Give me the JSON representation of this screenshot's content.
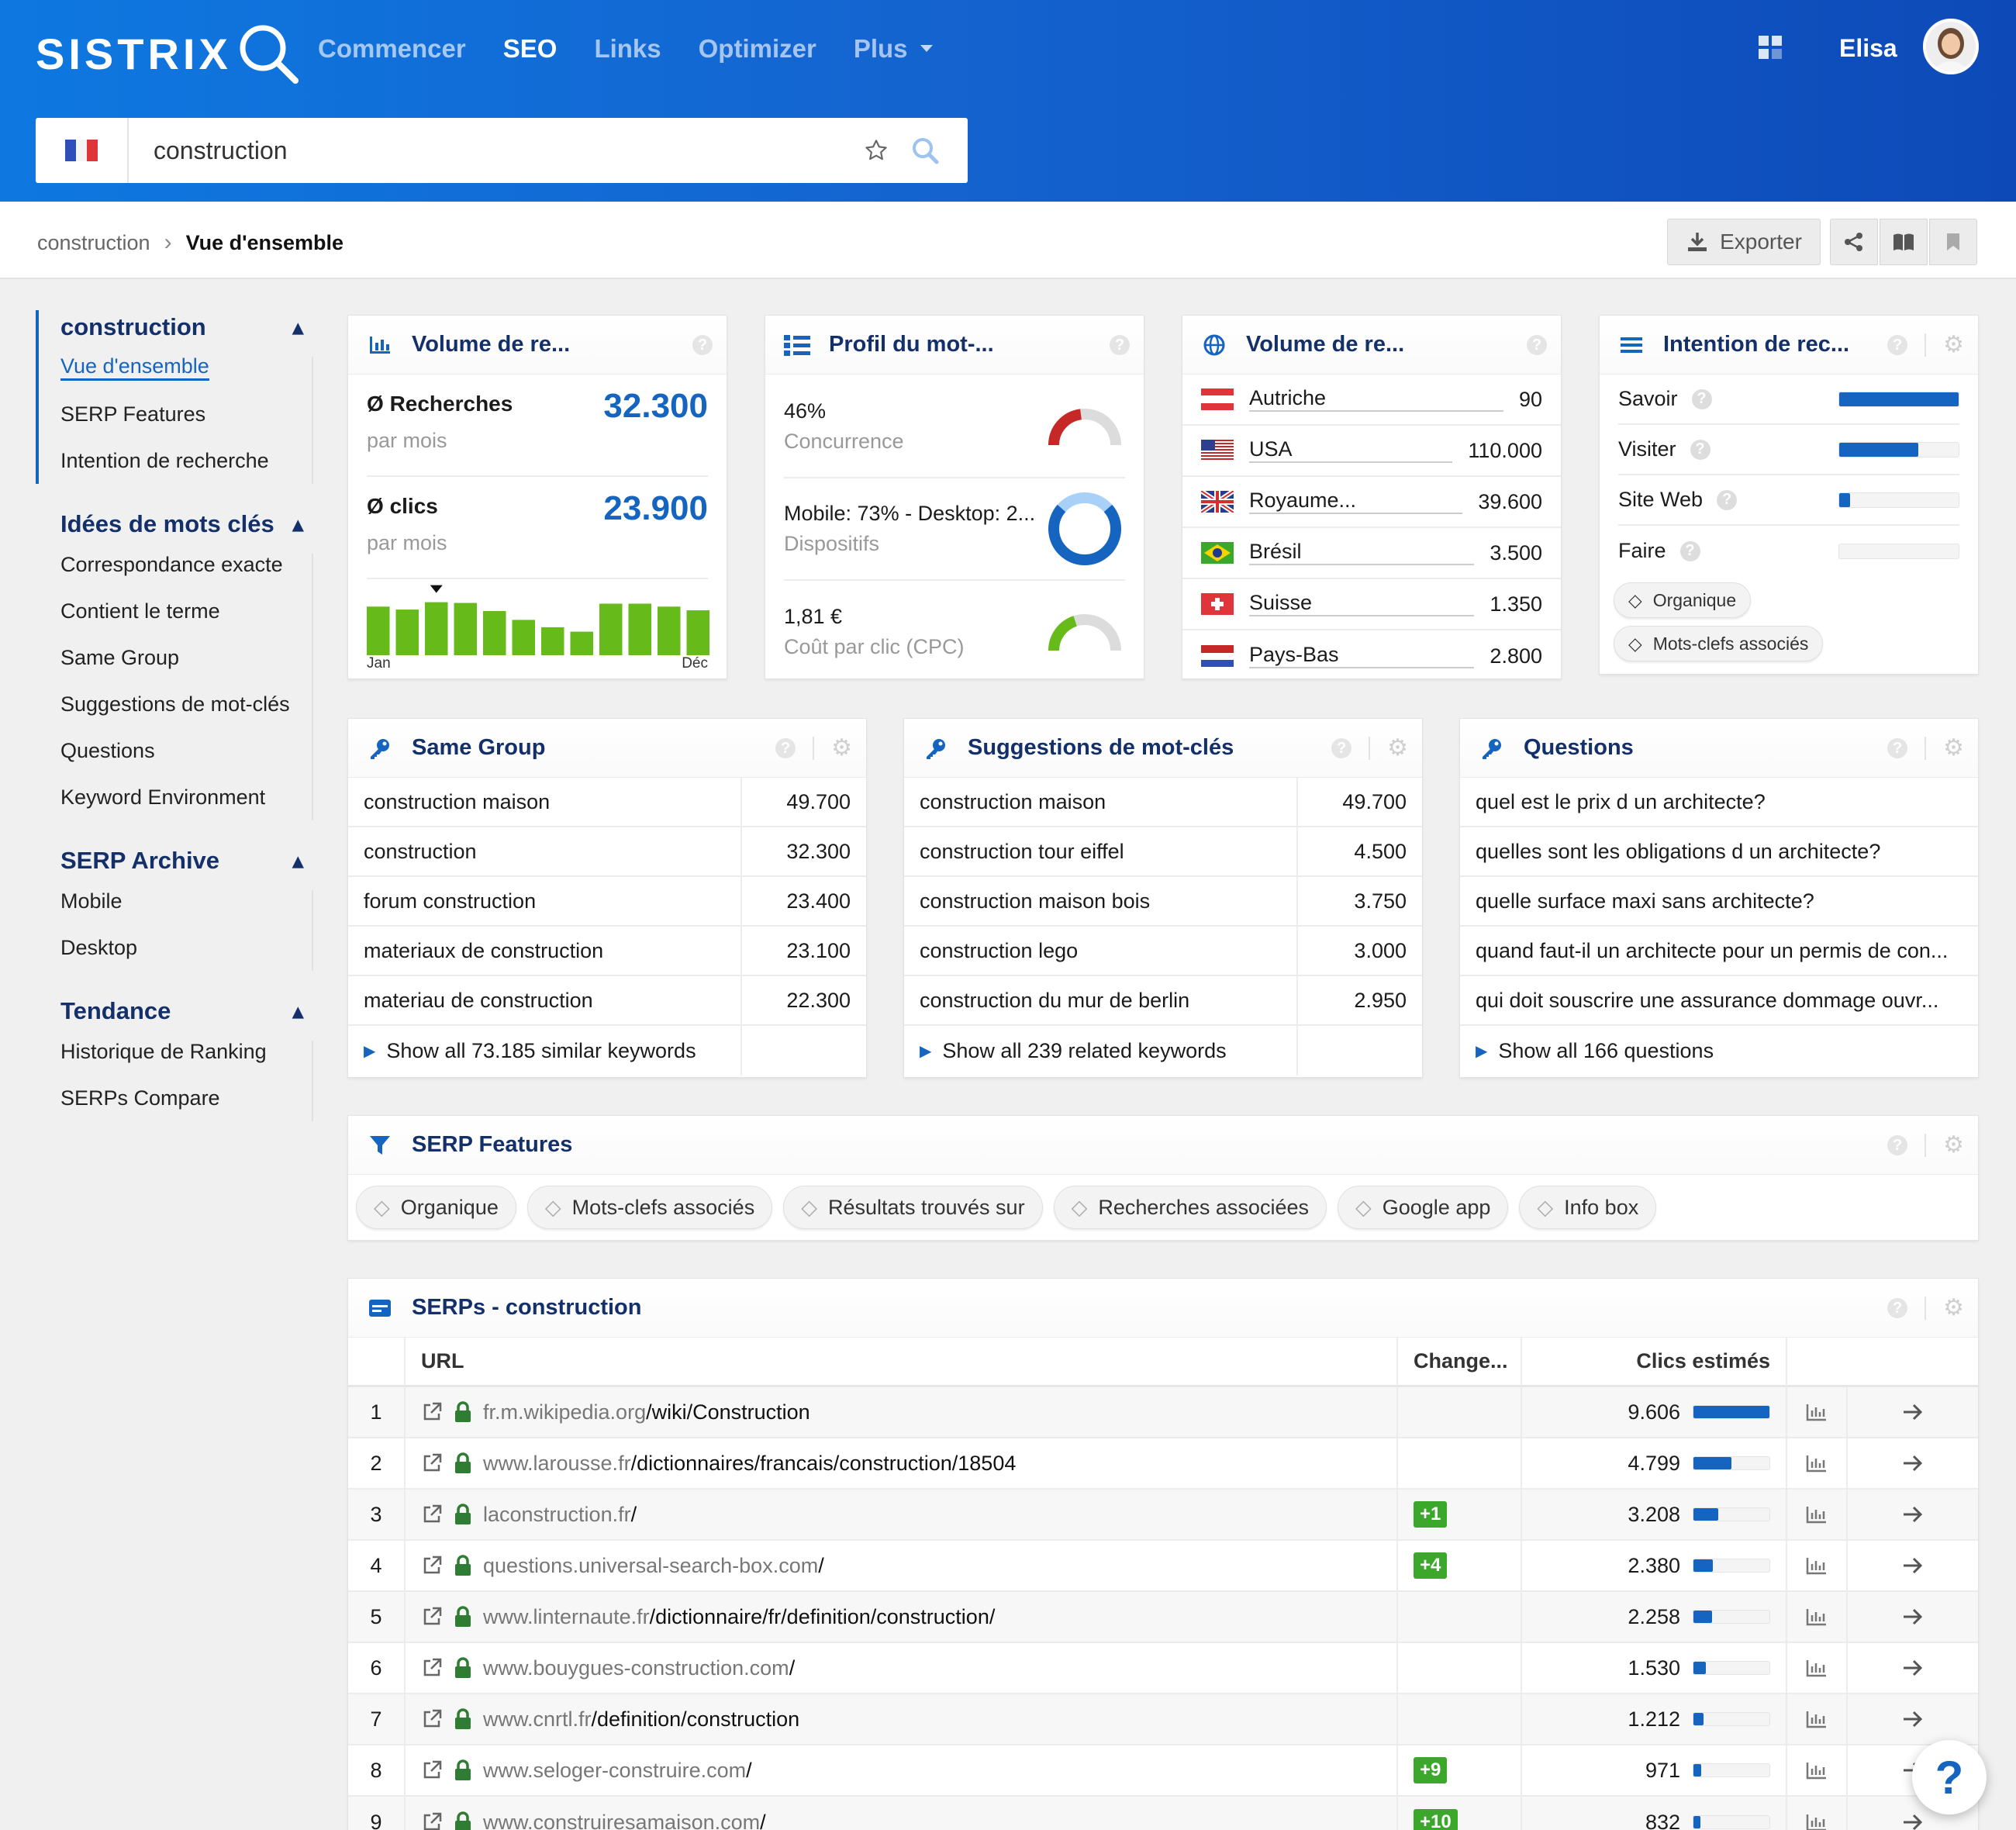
{
  "header": {
    "logo": "SISTRIX",
    "nav": [
      "Commencer",
      "SEO",
      "Links",
      "Optimizer",
      "Plus"
    ],
    "user": "Elisa"
  },
  "search": {
    "value": "construction"
  },
  "breadcrumb": {
    "parent": "construction",
    "current": "Vue d'ensemble"
  },
  "toolbar": {
    "export": "Exporter"
  },
  "sidebar": [
    {
      "title": "construction",
      "items": [
        "Vue d'ensemble",
        "SERP Features",
        "Intention de recherche"
      ]
    },
    {
      "title": "Idées de mots clés",
      "items": [
        "Correspondance exacte",
        "Contient le terme",
        "Same Group",
        "Suggestions de mot-clés",
        "Questions",
        "Keyword Environment"
      ]
    },
    {
      "title": "SERP Archive",
      "items": [
        "Mobile",
        "Desktop"
      ]
    },
    {
      "title": "Tendance",
      "items": [
        "Historique de Ranking",
        "SERPs Compare"
      ]
    }
  ],
  "volume": {
    "title": "Volume de re...",
    "searches_label": "Recherches",
    "searches_sub": "par mois",
    "searches": "32.300",
    "clicks_label": "clics",
    "clicks_sub": "par mois",
    "clicks": "23.900",
    "month_start": "Jan",
    "month_end": "Déc",
    "monthly": [
      0.66,
      0.62,
      0.72,
      0.71,
      0.6,
      0.48,
      0.38,
      0.32,
      0.7,
      0.7,
      0.66,
      0.61
    ],
    "marker_index": 2
  },
  "profile": {
    "title": "Profil du mot-...",
    "rows": [
      {
        "value": "46%",
        "label": "Concurrence",
        "pct": 0.46,
        "color": "#c62828"
      },
      {
        "value": "Mobile: 73% - Desktop: 2...",
        "label": "Dispositifs",
        "pct": 0.73,
        "color": "#1565c0"
      },
      {
        "value": "1,81 €",
        "label": "Coût par clic (CPC)",
        "pct": 0.4,
        "color": "#66bb1a"
      }
    ]
  },
  "countries": {
    "title": "Volume de re...",
    "rows": [
      {
        "name": "Autriche",
        "value": "90",
        "flag": "at"
      },
      {
        "name": "USA",
        "value": "110.000",
        "flag": "us"
      },
      {
        "name": "Royaume...",
        "value": "39.600",
        "flag": "gb"
      },
      {
        "name": "Brésil",
        "value": "3.500",
        "flag": "br"
      },
      {
        "name": "Suisse",
        "value": "1.350",
        "flag": "ch"
      },
      {
        "name": "Pays-Bas",
        "value": "2.800",
        "flag": "nl"
      }
    ]
  },
  "intent": {
    "title": "Intention de rec...",
    "rows": [
      {
        "label": "Savoir",
        "level": 1.0
      },
      {
        "label": "Visiter",
        "level": 0.66
      },
      {
        "label": "Site Web",
        "level": 0.09
      },
      {
        "label": "Faire",
        "level": 0.0
      }
    ],
    "tags": [
      "Organique",
      "Mots-clefs associés"
    ]
  },
  "same_group": {
    "title": "Same Group",
    "rows": [
      {
        "kw": "construction maison",
        "v": "49.700"
      },
      {
        "kw": "construction",
        "v": "32.300"
      },
      {
        "kw": "forum construction",
        "v": "23.400"
      },
      {
        "kw": "materiaux de construction",
        "v": "23.100"
      },
      {
        "kw": "materiau de construction",
        "v": "22.300"
      }
    ],
    "more": "Show all 73.185 similar keywords"
  },
  "suggestions": {
    "title": "Suggestions de mot-clés",
    "rows": [
      {
        "kw": "construction maison",
        "v": "49.700"
      },
      {
        "kw": "construction tour eiffel",
        "v": "4.500"
      },
      {
        "kw": "construction maison bois",
        "v": "3.750"
      },
      {
        "kw": "construction lego",
        "v": "3.000"
      },
      {
        "kw": "construction du mur de berlin",
        "v": "2.950"
      }
    ],
    "more": "Show all 239 related keywords"
  },
  "questions": {
    "title": "Questions",
    "rows": [
      "quel est le prix d un architecte?",
      "quelles sont les obligations d un architecte?",
      "quelle surface maxi sans architecte?",
      "quand faut-il un architecte pour un permis de con...",
      "qui doit souscrire une assurance dommage ouvr..."
    ],
    "more": "Show all 166 questions"
  },
  "serp_features": {
    "title": "SERP Features",
    "tags": [
      "Organique",
      "Mots-clefs associés",
      "Résultats trouvés sur",
      "Recherches associées",
      "Google app",
      "Info box"
    ]
  },
  "serps": {
    "title": "SERPs - construction",
    "headers": {
      "url": "URL",
      "change": "Change...",
      "clicks": "Clics estimés"
    },
    "rows": [
      {
        "pos": "1",
        "domain": "fr.m.wikipedia.org",
        "path": "/wiki/Construction",
        "change": "",
        "clicks": "9.606",
        "share": 1.0
      },
      {
        "pos": "2",
        "domain": "www.larousse.fr",
        "path": "/dictionnaires/francais/construction/18504",
        "change": "",
        "clicks": "4.799",
        "share": 0.5
      },
      {
        "pos": "3",
        "domain": "laconstruction.fr",
        "path": "/",
        "change": "+1",
        "clicks": "3.208",
        "share": 0.33
      },
      {
        "pos": "4",
        "domain": "questions.universal-search-box.com",
        "path": "/",
        "change": "+4",
        "clicks": "2.380",
        "share": 0.25
      },
      {
        "pos": "5",
        "domain": "www.linternaute.fr",
        "path": "/dictionnaire/fr/definition/construction/",
        "change": "",
        "clicks": "2.258",
        "share": 0.24
      },
      {
        "pos": "6",
        "domain": "www.bouygues-construction.com",
        "path": "/",
        "change": "",
        "clicks": "1.530",
        "share": 0.16
      },
      {
        "pos": "7",
        "domain": "www.cnrtl.fr",
        "path": "/definition/construction",
        "change": "",
        "clicks": "1.212",
        "share": 0.13
      },
      {
        "pos": "8",
        "domain": "www.seloger-construire.com",
        "path": "/",
        "change": "+9",
        "clicks": "971",
        "share": 0.1
      },
      {
        "pos": "9",
        "domain": "www.construiresamaison.com",
        "path": "/",
        "change": "+10",
        "clicks": "832",
        "share": 0.09
      }
    ]
  },
  "help": "?"
}
